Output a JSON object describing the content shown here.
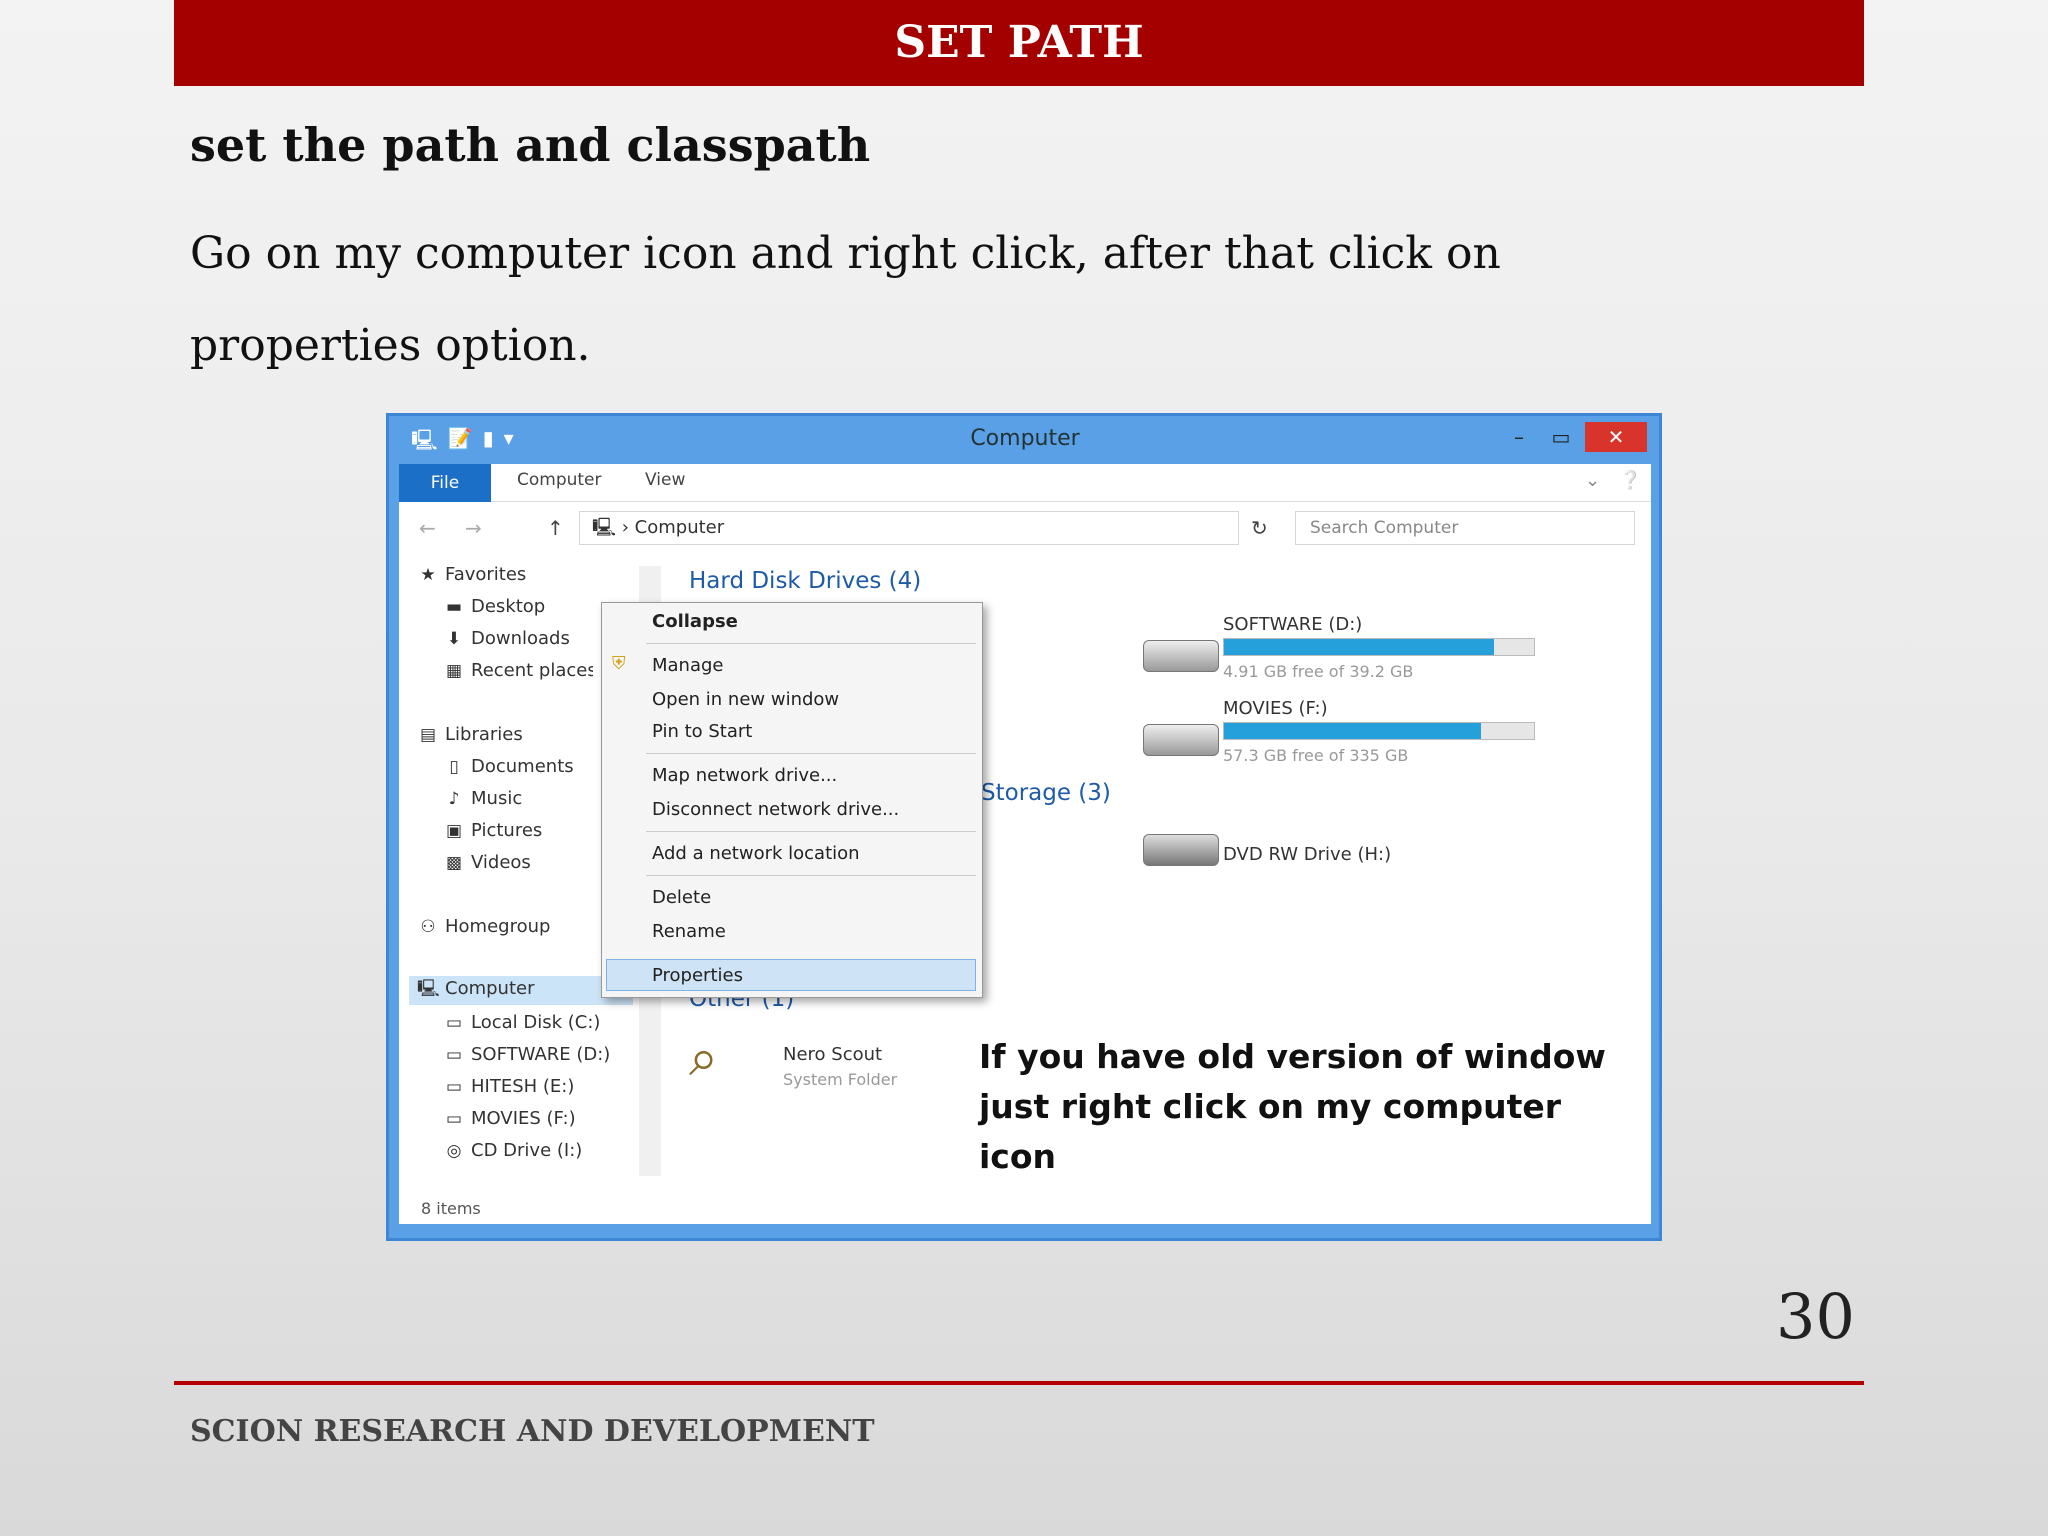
{
  "slide": {
    "title": "SET PATH",
    "heading": "set the path and classpath",
    "body": "Go on my computer icon and right click, after that click on properties option.",
    "page_number": "30",
    "footer": "SCION RESEARCH AND DEVELOPMENT",
    "accent_color": "#a50000"
  },
  "window": {
    "title": "Computer",
    "close_label": "✕",
    "ribbon_tabs": [
      "File",
      "Computer",
      "View"
    ],
    "address": "Computer",
    "search_placeholder": "Search Computer",
    "status": "8 items",
    "nav": {
      "favorites": "Favorites",
      "desktop": "Desktop",
      "downloads": "Downloads",
      "recent": "Recent places",
      "libraries": "Libraries",
      "documents": "Documents",
      "music": "Music",
      "pictures": "Pictures",
      "videos": "Videos",
      "homegroup": "Homegroup",
      "computer": "Computer",
      "local_c": "Local Disk (C:)",
      "software_d": "SOFTWARE (D:)",
      "hitesh_e": "HITESH (E:)",
      "movies_f": "MOVIES (F:)",
      "cd_i": "CD Drive (I:)"
    },
    "content": {
      "hdd_group": "Hard Disk Drives (4)",
      "storage_group": "Storage (3)",
      "other_group": "Other (1)",
      "software_drive": "SOFTWARE (D:)",
      "software_free": "4.91 GB free of 39.2 GB",
      "software_used_fraction": 0.87,
      "movies_drive": "MOVIES (F:)",
      "movies_free": "57.3 GB free of 335 GB",
      "movies_used_fraction": 0.83,
      "dvd_drive": "DVD RW Drive (H:)",
      "nero": "Nero Scout",
      "nero_sub": "System Folder"
    },
    "context_menu": [
      "Collapse",
      "Manage",
      "Open in new window",
      "Pin to Start",
      "Map network drive...",
      "Disconnect network drive...",
      "Add a network location",
      "Delete",
      "Rename",
      "Properties"
    ],
    "annotation": "If you have old version of window just right click on my computer icon"
  }
}
